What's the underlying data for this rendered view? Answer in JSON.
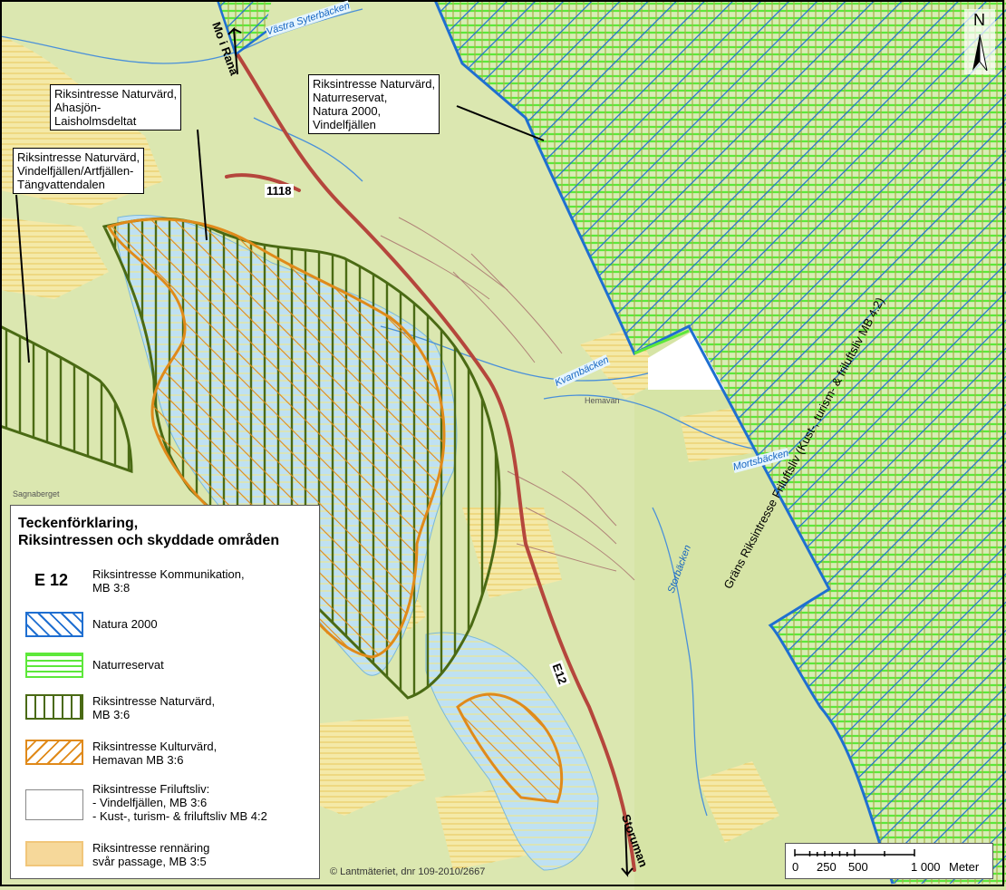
{
  "callouts": {
    "naturvard_ahasjon": "Riksintresse Naturvärd,\nAhasjön-\nLaisholmsdeltat",
    "naturvard_vindelfjallen": "Riksintresse Naturvärd,\nVindelfjällen/Artfjällen-\nTängvattendalen",
    "naturvard_reservat": "Riksintresse Naturvärd,\nNaturreservat,\nNatura 2000,\nVindelfjällen"
  },
  "roads": {
    "e12": "E12",
    "road_1118": "1118",
    "to_mo_i_rana": "Mo i Rana",
    "to_storuman": "Storuman"
  },
  "streams": {
    "vastra_syterbacken": "Västra Syterbäcken",
    "kvarnbacken": "Kvarnbäcken",
    "mortsbacken": "Mortsbäcken",
    "storbacken": "Storbäcken"
  },
  "places": {
    "hemavan": "Hemavan",
    "sagnaberget": "Sagnaberget"
  },
  "boundary_label": "Gräns Riksintresse Friluftsliv (Kust-, turism- & friluftsliv MB 4:2)",
  "north_arrow": {
    "letter": "N",
    "icon": "north-arrow-icon"
  },
  "legend": {
    "title": "Teckenförklaring,\nRiksintressen och skyddade områden",
    "items": [
      {
        "symbol": "E 12",
        "label": "Riksintresse Kommunikation,\nMB 3:8"
      },
      {
        "label": "Natura 2000",
        "color": "#1f6fd1"
      },
      {
        "label": "Naturreservat",
        "color": "#5de83a"
      },
      {
        "label": "Riksintresse Naturvärd,\nMB 3:6",
        "color": "#4a6a14"
      },
      {
        "label": "Riksintresse Kulturvärd,\nHemavan MB 3:6",
        "color": "#e08a1a"
      },
      {
        "label": "Riksintresse Friluftsliv:\n - Vindelfjällen, MB 3:6\n - Kust-, turism- & friluftsliv MB 4:2",
        "color": "#ffffff"
      },
      {
        "label": "Riksintresse rennäring\nsvår passage, MB 3:5",
        "color": "#f6d89a"
      }
    ]
  },
  "scale": {
    "ticks": [
      "0",
      "250",
      "500",
      "1 000"
    ],
    "unit": "Meter"
  },
  "copyright": "© Lantmäteriet, dnr 109-2010/2667",
  "colors": {
    "background": "#d6e4a6",
    "natura2000": "#1f6fd1",
    "naturreservat": "#5de83a",
    "naturvard": "#4a6a14",
    "kulturvard": "#e08a1a",
    "rennaring": "#f6d89a",
    "water": "#bfe1f2",
    "road_red": "#b5463c"
  }
}
